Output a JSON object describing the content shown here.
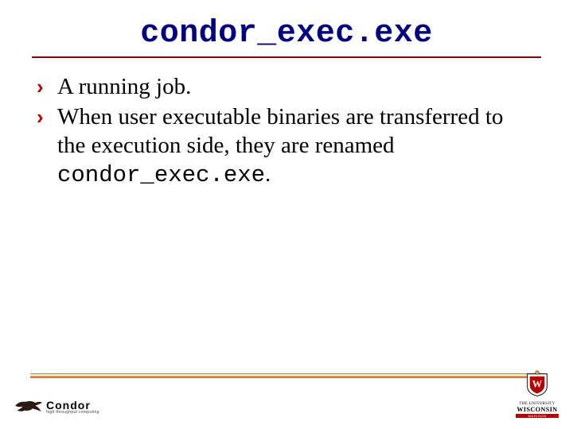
{
  "title": "condor_exec.exe",
  "bullets": [
    {
      "text": "A running job."
    },
    {
      "text_pre": "When user executable binaries are transferred to the execution side, they are renamed ",
      "code": "condor_exec.exe",
      "text_post": "."
    }
  ],
  "footer": {
    "condor": {
      "word": "Condor",
      "sub": "high throughput computing"
    },
    "wisconsin": {
      "top": "THE UNIVERSITY",
      "name": "WISCONSIN",
      "bar": "MADISON"
    }
  },
  "colors": {
    "title": "#000080",
    "accent": "#b80000",
    "footer_line": "#c27835"
  }
}
